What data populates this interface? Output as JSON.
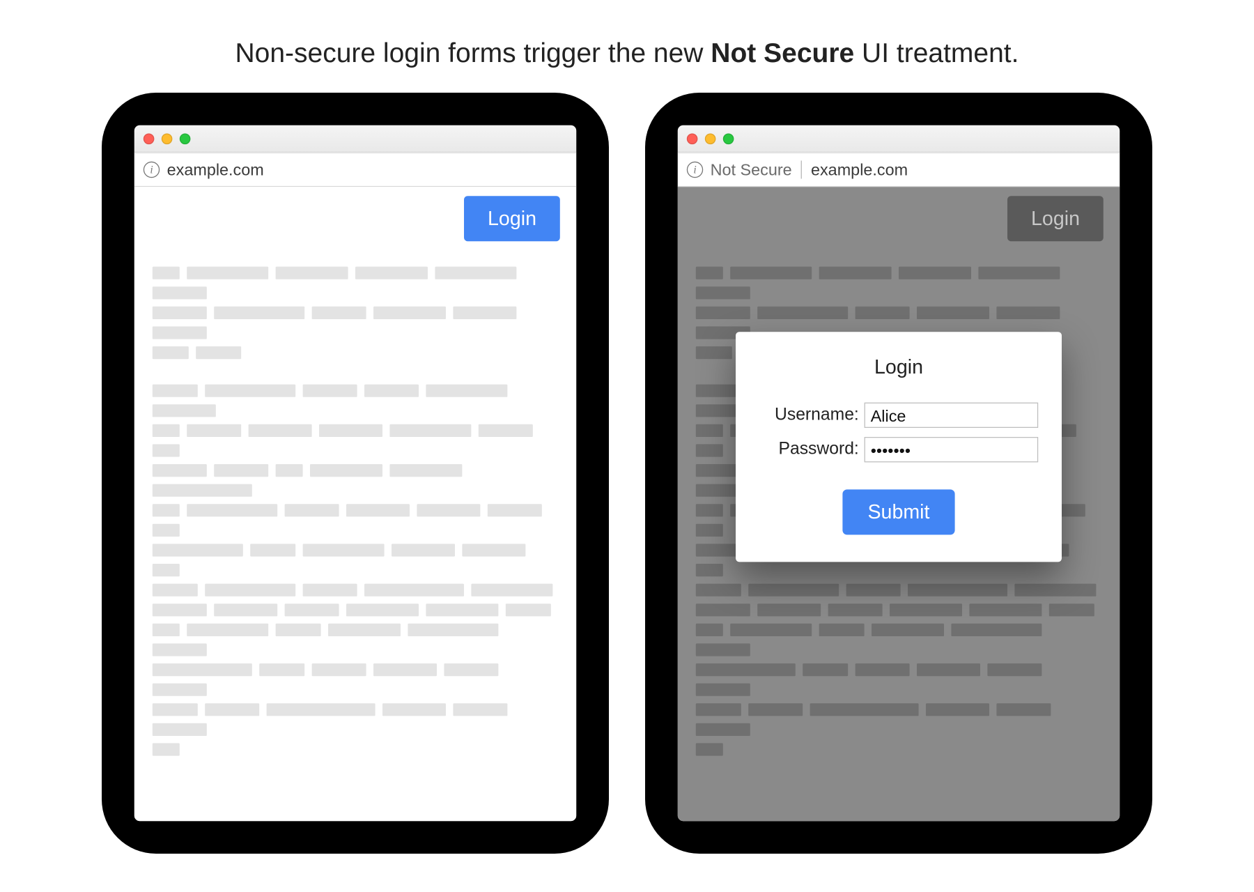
{
  "caption": {
    "prefix": "Non-secure login forms trigger the new ",
    "bold": "Not Secure",
    "suffix": " UI treatment."
  },
  "left": {
    "omnibox": {
      "url": "example.com"
    },
    "login_button": "Login"
  },
  "right": {
    "omnibox": {
      "status": "Not Secure",
      "url": "example.com"
    },
    "login_button": "Login",
    "modal": {
      "title": "Login",
      "username_label": "Username:",
      "username_value": "Alice",
      "password_label": "Password:",
      "password_value": "•••••••",
      "submit_label": "Submit"
    }
  },
  "colors": {
    "accent": "#4285f4",
    "placeholder": "#e3e3e3"
  },
  "filler": {
    "para1": [
      [
        30,
        90,
        80,
        80,
        90,
        60
      ],
      [
        60,
        100,
        60,
        80,
        70,
        60
      ],
      [
        40,
        50
      ]
    ],
    "para2": [
      [
        50,
        100,
        60,
        60,
        90,
        70
      ],
      [
        30,
        60,
        70,
        70,
        90,
        60,
        30
      ],
      [
        60,
        60,
        30,
        80,
        80,
        110
      ],
      [
        30,
        100,
        60,
        70,
        70,
        60,
        30
      ],
      [
        100,
        50,
        90,
        70,
        70,
        30
      ],
      [
        50,
        100,
        60,
        110,
        90
      ],
      [
        60,
        70,
        60,
        80,
        80,
        50
      ],
      [
        30,
        90,
        50,
        80,
        100,
        60
      ],
      [
        110,
        50,
        60,
        70,
        60,
        60
      ],
      [
        50,
        60,
        120,
        70,
        60,
        60
      ],
      [
        30
      ]
    ]
  }
}
